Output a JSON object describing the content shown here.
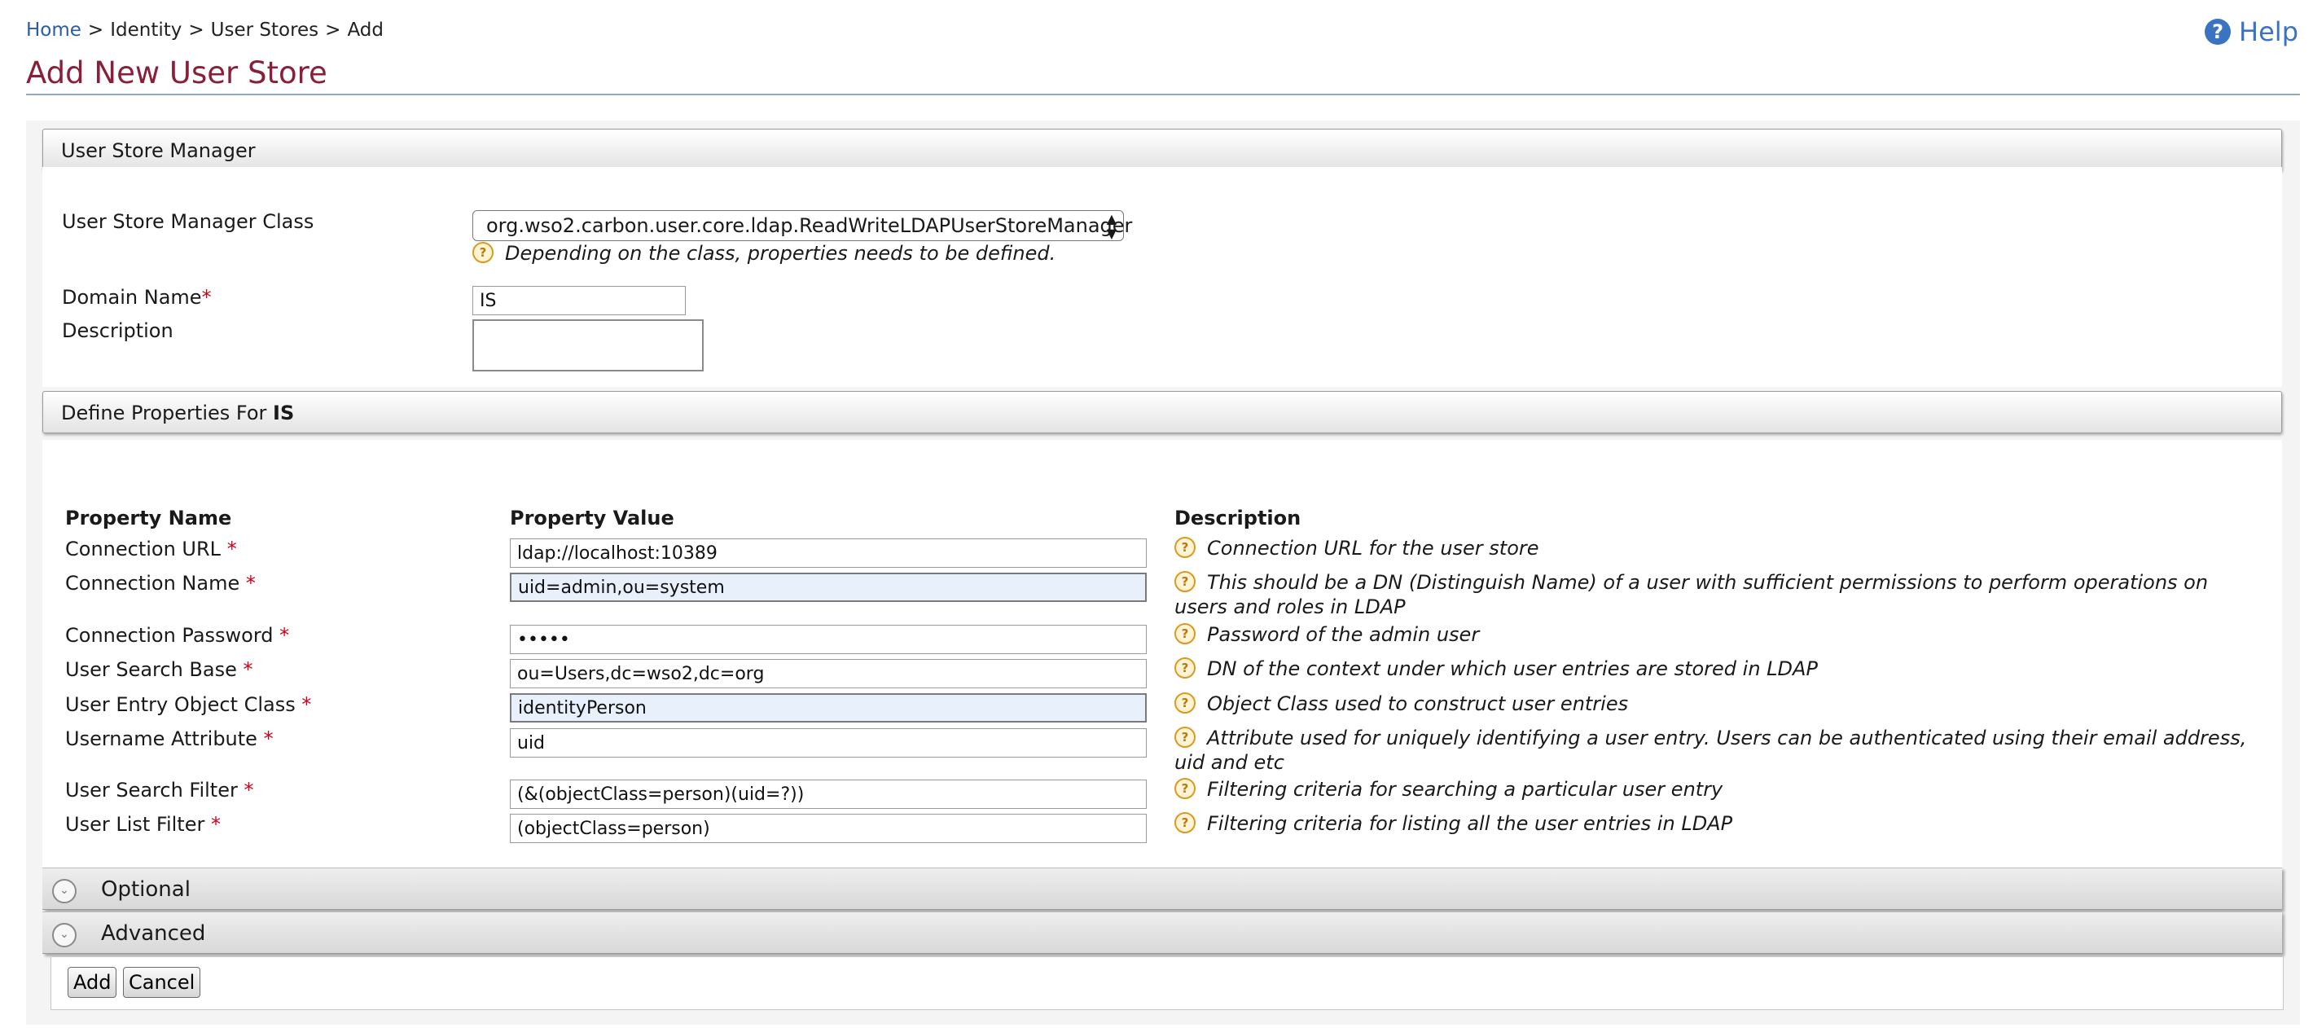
{
  "breadcrumb": {
    "home": "Home",
    "sep": ">",
    "identity": "Identity",
    "user_stores": "User Stores",
    "add": "Add"
  },
  "help": {
    "label": "Help",
    "icon": "help-circle-icon"
  },
  "page_title": "Add New User Store",
  "user_store_manager": {
    "header": "User Store Manager",
    "class_label": "User Store Manager Class",
    "class_value": "org.wso2.carbon.user.core.ldap.ReadWriteLDAPUserStoreManager",
    "class_hint": "Depending on the class, properties needs to be defined.",
    "domain_label": "Domain Name",
    "required_mark": "*",
    "domain_value": "IS",
    "description_label": "Description",
    "description_value": ""
  },
  "properties": {
    "header_prefix": "Define Properties For ",
    "header_domain": "IS",
    "col_name": "Property Name",
    "col_value": "Property Value",
    "col_desc": "Description",
    "rows": [
      {
        "name": "Connection URL",
        "value": "ldap://localhost:10389",
        "desc": "Connection URL for the user store"
      },
      {
        "name": "Connection Name",
        "value": "uid=admin,ou=system",
        "desc": "This should be a DN (Distinguish Name) of a user with sufficient permissions to perform operations on users and roles in LDAP"
      },
      {
        "name": "Connection Password",
        "value": "•••••",
        "desc": "Password of the admin user"
      },
      {
        "name": "User Search Base",
        "value": "ou=Users,dc=wso2,dc=org",
        "desc": "DN of the context under which user entries are stored in LDAP"
      },
      {
        "name": "User Entry Object Class",
        "value": "identityPerson",
        "desc": "Object Class used to construct user entries"
      },
      {
        "name": "Username Attribute",
        "value": "uid",
        "desc": "Attribute used for uniquely identifying a user entry. Users can be authenticated using their email address, uid and etc"
      },
      {
        "name": "User Search Filter",
        "value": "(&(objectClass=person)(uid=?))",
        "desc": "Filtering criteria for searching a particular user entry"
      },
      {
        "name": "User List Filter",
        "value": "(objectClass=person)",
        "desc": "Filtering criteria for listing all the user entries in LDAP"
      }
    ]
  },
  "sections": {
    "optional": "Optional",
    "advanced": "Advanced"
  },
  "buttons": {
    "add": "Add",
    "cancel": "Cancel"
  },
  "colors": {
    "title": "#8a1f3a",
    "link": "#2a5d9f",
    "required": "#d0021b",
    "help": "#3a73c2"
  }
}
